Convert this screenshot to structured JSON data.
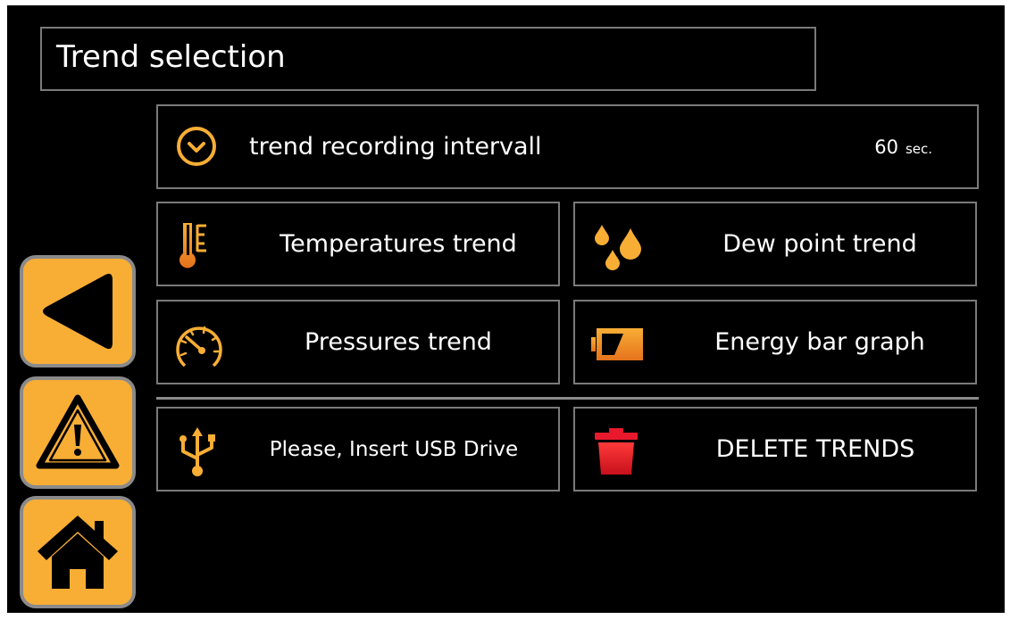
{
  "header": {
    "title": "Trend selection"
  },
  "interval": {
    "label": "trend recording intervall",
    "value": "60",
    "unit": "sec."
  },
  "menu": {
    "temperatures": "Temperatures trend",
    "dew_point": "Dew point trend",
    "pressures": "Pressures trend",
    "energy": "Energy bar graph",
    "usb": "Please, Insert USB Drive",
    "delete": "DELETE TRENDS"
  },
  "sidebar": {
    "back_icon": "back-arrow-icon",
    "alarm_icon": "warning-icon",
    "home_icon": "home-icon"
  },
  "colors": {
    "accent": "#f8ae35",
    "border": "#7a7a7a",
    "delete": "#e8192c",
    "background": "#000000"
  }
}
